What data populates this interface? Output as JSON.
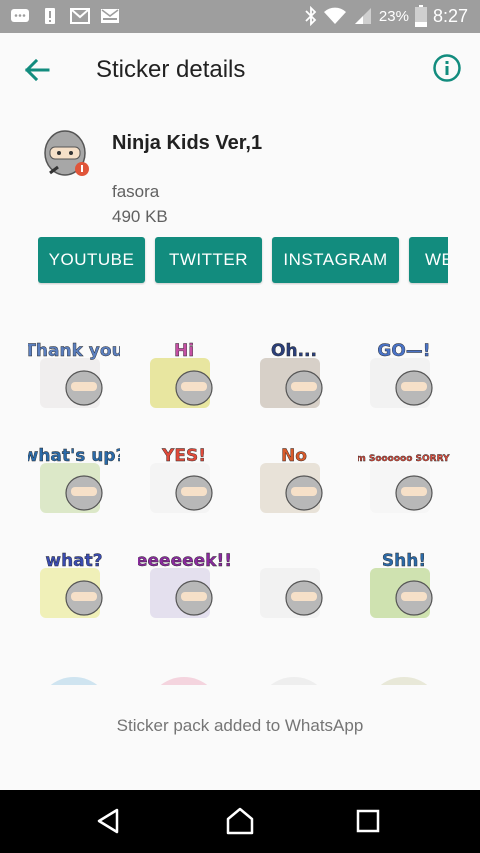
{
  "status_bar": {
    "battery_pct": "23%",
    "time": "8:27",
    "icons": [
      "messenger-icon",
      "notification-icon",
      "gmail-icon",
      "mail-icon",
      "bluetooth-icon",
      "wifi-icon",
      "signal-icon",
      "battery-icon"
    ]
  },
  "toolbar": {
    "title": "Sticker details",
    "back_icon": "arrow-left-icon",
    "info_icon": "info-icon"
  },
  "pack": {
    "name": "Ninja Kids Ver,1",
    "author": "fasora",
    "size": "490 KB"
  },
  "buttons": [
    {
      "label": "YOUTUBE"
    },
    {
      "label": "TWITTER"
    },
    {
      "label": "INSTAGRAM"
    },
    {
      "label": "WE"
    }
  ],
  "stickers": [
    {
      "text": "Thank you",
      "color": "#5b7fbf"
    },
    {
      "text": "Hi",
      "color": "#c44fa3"
    },
    {
      "text": "Oh...",
      "color": "#2b3f7a"
    },
    {
      "text": "GO—!",
      "color": "#4a73c7"
    },
    {
      "text": "what's up?",
      "color": "#2b6aa8"
    },
    {
      "text": "YES!",
      "color": "#e04a3a"
    },
    {
      "text": "No",
      "color": "#d85a2a"
    },
    {
      "text": "I'm Soooooo SORRY!!",
      "color": "#e04a3a"
    },
    {
      "text": "what?",
      "color": "#3a4bb0"
    },
    {
      "text": "eeeeeek!!",
      "color": "#8a2a9e"
    },
    {
      "text": "",
      "color": "#9e9e9e"
    },
    {
      "text": "Shh!",
      "color": "#2b6aa8"
    }
  ],
  "footer": {
    "message": "Sticker pack added to WhatsApp"
  },
  "colors": {
    "accent": "#128c7e",
    "status_bar": "#9e9e9e"
  }
}
